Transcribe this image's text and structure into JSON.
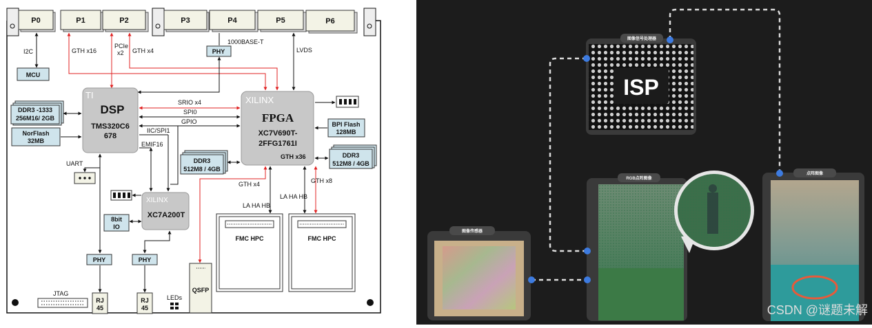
{
  "left": {
    "ports": [
      "P0",
      "P1",
      "P2",
      "P3",
      "P4",
      "P5",
      "P6"
    ],
    "dsp": {
      "brand": "TI",
      "title": "DSP",
      "part1": "TMS320C6",
      "part2": "678"
    },
    "fpga": {
      "brand": "XILINX",
      "title": "FPGA",
      "part1": "XC7V690T-",
      "part2": "2FFG1761I",
      "gth": "GTH x36"
    },
    "small_fpga": {
      "brand": "XILINX",
      "part": "XC7A200T"
    },
    "mcu": "MCU",
    "ddr_dsp": {
      "l1": "DDR3 -1333",
      "l2": "256M16/ 2GB"
    },
    "norflash": {
      "l1": "NorFlash",
      "l2": "32MB"
    },
    "bpi": {
      "l1": "BPI Flash",
      "l2": "128MB"
    },
    "ddr_fpga_left": {
      "l1": "DDR3",
      "l2": "512M8 / 4GB"
    },
    "ddr_fpga_right": {
      "l1": "DDR3",
      "l2": "512M8 / 4GB"
    },
    "io": {
      "l1": "8bit",
      "l2": "IO"
    },
    "fmc1": "FMC HPC",
    "fmc2": "FMC HPC",
    "qsfp": "QSFP",
    "phy": "PHY",
    "rj": {
      "l1": "RJ",
      "l2": "45"
    },
    "labels": {
      "i2c": "I2C",
      "gth_x16": "GTH x16",
      "pcie": "PCIe",
      "x2": "x2",
      "gth_x4_top": "GTH x4",
      "base1000": "1000BASE-T",
      "lvds": "LVDS",
      "srio": "SRIO x4",
      "spi0": "SPI0",
      "gpio": "GPIO",
      "iic": "IIC/SPI1",
      "emif": "EMIF16",
      "uart": "UART",
      "gth_x4": "GTH x4",
      "gth_x8": "GTH x8",
      "laha1": "LA HA HB",
      "laha2": "LA HA HB",
      "jtag": "JTAG",
      "leds": "LEDs"
    }
  },
  "right": {
    "isp_label": "图像信号处理器",
    "isp_text": "ISP",
    "rgb_label": "RGB点阵图像",
    "sensor_label": "图像传感器",
    "final_label": "点阵图像",
    "watermark": "CSDN @谜题未解"
  }
}
